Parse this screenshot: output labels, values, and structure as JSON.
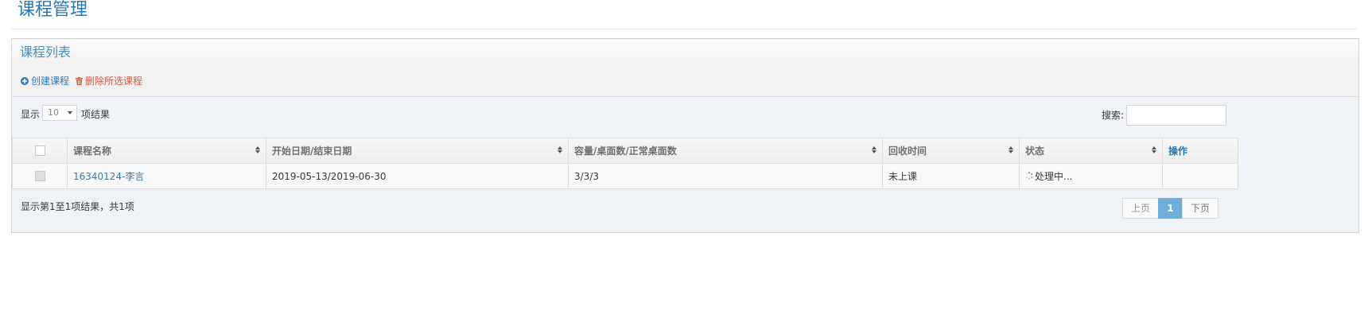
{
  "page": {
    "title": "课程管理"
  },
  "panel": {
    "title": "课程列表",
    "toolbar": {
      "create_label": "创建课程",
      "delete_label": "删除所选课程"
    }
  },
  "controls": {
    "length_label_before": "显示",
    "length_value": "10",
    "length_label_after": "项结果",
    "search_label": "搜索:",
    "search_value": ""
  },
  "table": {
    "headers": [
      "课程名称",
      "开始日期/结束日期",
      "容量/桌面数/正常桌面数",
      "回收时间",
      "状态",
      "操作"
    ],
    "rows": [
      {
        "name": "16340124-李言",
        "dates": "2019-05-13/2019-06-30",
        "capacity": "3/3/3",
        "recycle": "未上课",
        "status": "处理中...",
        "ops": ""
      }
    ]
  },
  "footer": {
    "info": "显示第1至1项结果，共1项",
    "prev": "上页",
    "current": "1",
    "next": "下页"
  },
  "colors": {
    "title": "#2679b5",
    "link": "#337ab7",
    "danger": "#d15b47",
    "page_active": "#6faed9"
  }
}
